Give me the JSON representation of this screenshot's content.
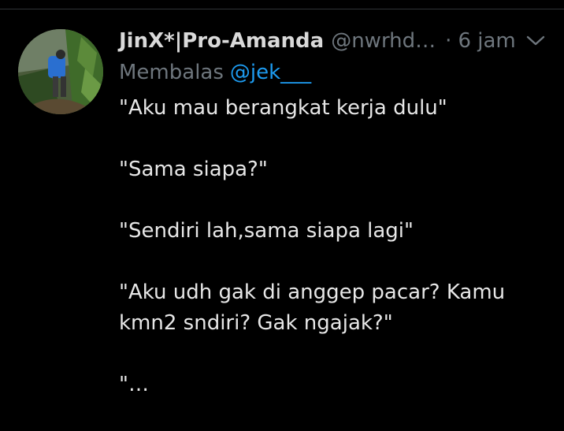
{
  "tweet": {
    "display_name": "JinX*|Pro-Amanda",
    "handle": "@nwrhd…",
    "separator": "·",
    "time": "6 jam",
    "reply_prefix": "Membalas",
    "reply_mention": "@jek___",
    "paragraphs": [
      "\"Aku mau berangkat kerja dulu\"",
      "\"Sama siapa?\"",
      "\"Sendiri lah,sama siapa lagi\"",
      "\"Aku udh gak di anggep pacar? Kamu kmn2 sndiri? Gak ngajak?\"",
      "\"…"
    ]
  },
  "icons": {
    "more": "chevron-down-icon",
    "avatar": "avatar"
  },
  "colors": {
    "background": "#000000",
    "primary_text": "#e7e7e7",
    "secondary_text": "#6e767d",
    "mention": "#1d9bf0"
  }
}
